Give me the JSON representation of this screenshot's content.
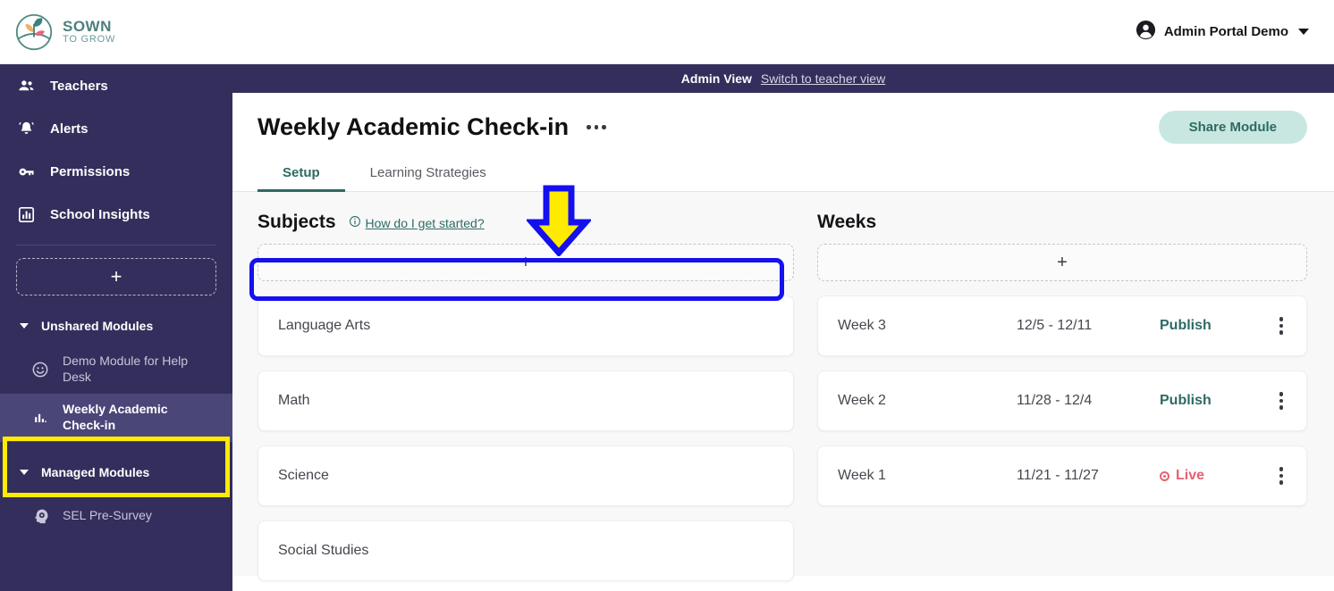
{
  "topbar": {
    "logo_name": "sown-to-grow-logo",
    "brand_line1": "SOWN",
    "brand_line2": "TO GROW",
    "account_name": "Admin Portal Demo",
    "account_icon": "user-circle-icon",
    "caret_icon": "chevron-down-icon"
  },
  "adminbar": {
    "label": "Admin View",
    "switch_link": "Switch to teacher view"
  },
  "sidebar": {
    "nav": [
      {
        "label": "Teachers",
        "icon": "people-icon"
      },
      {
        "label": "Alerts",
        "icon": "bell-icon"
      },
      {
        "label": "Permissions",
        "icon": "key-icon"
      },
      {
        "label": "School Insights",
        "icon": "bar-chart-box-icon"
      }
    ],
    "add_module_label": "+",
    "groups": [
      {
        "label": "Unshared Modules",
        "chevron": "chevron-down-icon",
        "items": [
          {
            "label": "Demo Module for Help Desk",
            "icon": "smiley-face-icon",
            "active": false
          },
          {
            "label": "Weekly Academic Check-in",
            "icon": "bar-chart-icon",
            "active": true
          }
        ]
      },
      {
        "label": "Managed Modules",
        "chevron": "chevron-down-icon",
        "items": [
          {
            "label": "SEL Pre-Survey",
            "icon": "head-gear-icon",
            "active": false
          }
        ]
      }
    ]
  },
  "main": {
    "page_title": "Weekly Academic Check-in",
    "title_menu_icon": "ellipsis-horizontal-icon",
    "share_button": "Share Module",
    "tabs": [
      {
        "label": "Setup",
        "active": true
      },
      {
        "label": "Learning Strategies",
        "active": false
      }
    ],
    "subjects": {
      "title": "Subjects",
      "help_icon": "info-circle-icon",
      "help_link": "How do I get started?",
      "add_label": "+",
      "items": [
        {
          "name": "Language Arts"
        },
        {
          "name": "Math"
        },
        {
          "name": "Science"
        },
        {
          "name": "Social Studies"
        }
      ]
    },
    "weeks": {
      "title": "Weeks",
      "add_label": "+",
      "menu_icon": "ellipsis-vertical-icon",
      "items": [
        {
          "name": "Week 3",
          "range": "12/5 - 12/11",
          "status": "Publish",
          "live": false
        },
        {
          "name": "Week 2",
          "range": "11/28 - 12/4",
          "status": "Publish",
          "live": false
        },
        {
          "name": "Week 1",
          "range": "11/21 - 11/27",
          "status": "Live",
          "live": true
        }
      ]
    }
  },
  "annotations": {
    "arrow_icon": "down-arrow-annotation",
    "arrow_fill": "#ffeb00",
    "arrow_stroke": "#1410f0",
    "box_color": "#1410f0",
    "sidebar_box_color": "#ffeb00"
  },
  "colors": {
    "sidebar_bg": "#332e5c",
    "sidebar_active": "#4b4678",
    "teal": "#2e6a63",
    "share_bg": "#c8e7e0",
    "live_red": "#e8616f",
    "content_bg": "#f8f8f9"
  }
}
